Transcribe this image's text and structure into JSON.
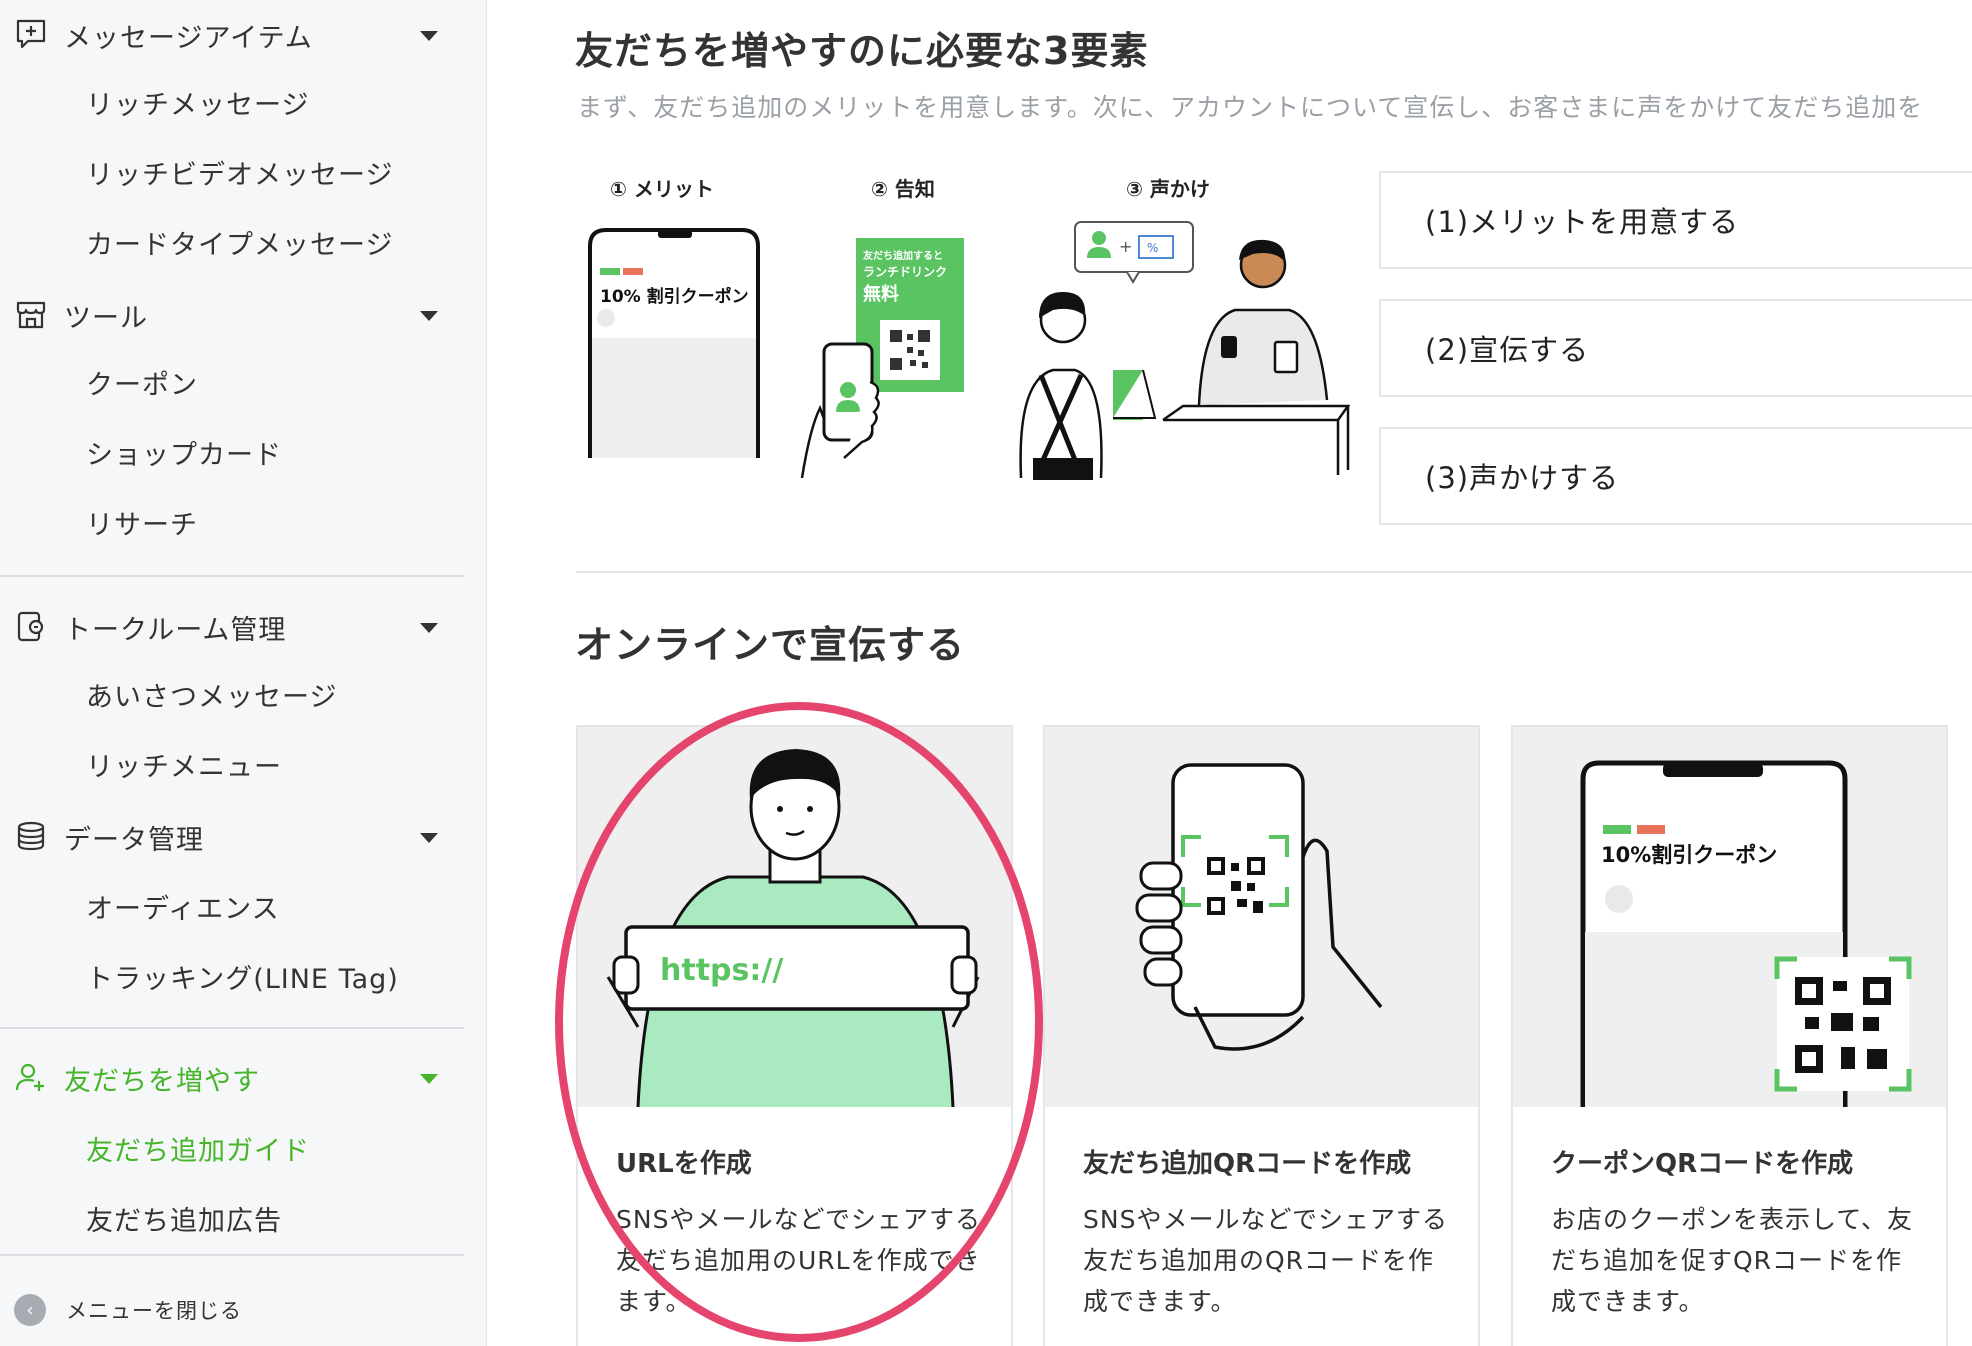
{
  "sidebar": {
    "groups": [
      {
        "label": "メッセージアイテム",
        "icon": "message-plus-icon",
        "items": [
          "リッチメッセージ",
          "リッチビデオメッセージ",
          "カードタイプメッセージ"
        ]
      },
      {
        "label": "ツール",
        "icon": "store-icon",
        "items": [
          "クーポン",
          "ショップカード",
          "リサーチ"
        ]
      },
      {
        "label": "トークルーム管理",
        "icon": "chat-room-icon",
        "items": [
          "あいさつメッセージ",
          "リッチメニュー"
        ]
      },
      {
        "label": "データ管理",
        "icon": "database-icon",
        "items": [
          "オーディエンス",
          "トラッキング(LINE Tag)"
        ]
      },
      {
        "label": "友だちを増やす",
        "icon": "add-friend-icon",
        "items": [
          "友だち追加ガイド",
          "友だち追加広告"
        ]
      }
    ],
    "close_menu": "メニューを閉じる",
    "active_color": "#45b52b"
  },
  "main": {
    "title": "友だちを増やすのに必要な3要素",
    "description": "まず、友だち追加のメリットを用意します。次に、アカウントについて宣伝し、お客さまに声をかけて友だち追加を",
    "steps": [
      {
        "label": "① メリット",
        "coupon_text": "10% 割引クーポン"
      },
      {
        "label": "② 告知",
        "poster_line1": "友だち追加すると",
        "poster_line2": "ランチドリンク",
        "poster_line3": "無料"
      },
      {
        "label": "③ 声かけ"
      }
    ],
    "menu_cards": [
      "(1)メリットを用意する",
      "(2)宣伝する",
      "(3)声かけする"
    ],
    "section_title": "オンラインで宣伝する",
    "cards": [
      {
        "title": "URLを作成",
        "description": "SNSやメールなどでシェアする友だち追加用のURLを作成できます。",
        "image_text": "https://"
      },
      {
        "title": "友だち追加QRコードを作成",
        "description": "SNSやメールなどでシェアする友だち追加用のQRコードを作成できます。"
      },
      {
        "title": "クーポンQRコードを作成",
        "description": "お店のクーポンを表示して、友だち追加を促すQRコードを作成できます。",
        "image_text": "10%割引クーポン"
      }
    ],
    "highlight_color": "#e5446d",
    "brand_green": "#5ac463"
  }
}
